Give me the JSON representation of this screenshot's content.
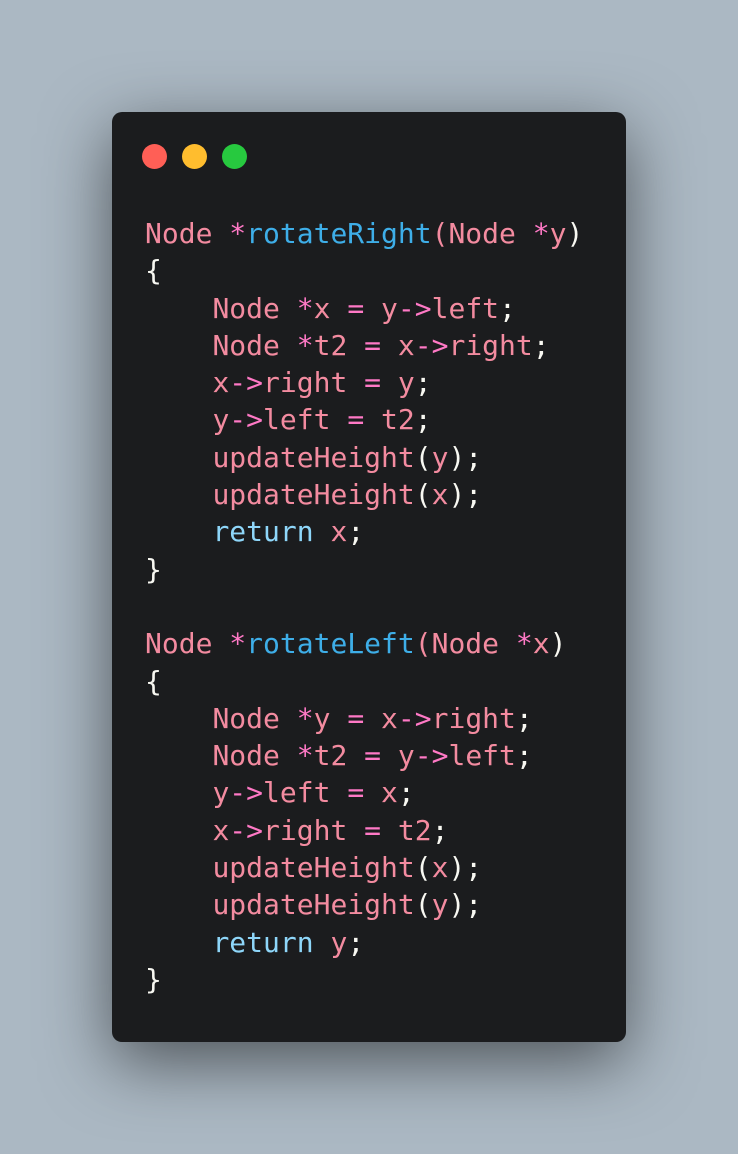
{
  "window": {
    "controls": [
      {
        "name": "close",
        "color": "#ff5f56"
      },
      {
        "name": "minimize",
        "color": "#ffbd2e"
      },
      {
        "name": "maximize",
        "color": "#27c93f"
      }
    ]
  },
  "palette": {
    "plain": "#f8f8f2",
    "pink": "#f38ba0",
    "operator": "#ff79c6",
    "function": "#3eaee8",
    "keyword": "#8ed6f9"
  },
  "code": {
    "lines": [
      [
        {
          "t": "Node",
          "c": "pink"
        },
        {
          "t": " ",
          "c": "plain"
        },
        {
          "t": "*",
          "c": "operator"
        },
        {
          "t": "rotateRight",
          "c": "function"
        },
        {
          "t": "(",
          "c": "pink"
        },
        {
          "t": "Node",
          "c": "pink"
        },
        {
          "t": " ",
          "c": "plain"
        },
        {
          "t": "*",
          "c": "operator"
        },
        {
          "t": "y",
          "c": "pink"
        },
        {
          "t": ")",
          "c": "plain"
        }
      ],
      [
        {
          "t": "{",
          "c": "plain"
        }
      ],
      [
        {
          "t": "    ",
          "c": "plain"
        },
        {
          "t": "Node",
          "c": "pink"
        },
        {
          "t": " ",
          "c": "plain"
        },
        {
          "t": "*",
          "c": "operator"
        },
        {
          "t": "x",
          "c": "pink"
        },
        {
          "t": " ",
          "c": "plain"
        },
        {
          "t": "=",
          "c": "operator"
        },
        {
          "t": " ",
          "c": "plain"
        },
        {
          "t": "y",
          "c": "pink"
        },
        {
          "t": "->",
          "c": "operator"
        },
        {
          "t": "left",
          "c": "pink"
        },
        {
          "t": ";",
          "c": "plain"
        }
      ],
      [
        {
          "t": "    ",
          "c": "plain"
        },
        {
          "t": "Node",
          "c": "pink"
        },
        {
          "t": " ",
          "c": "plain"
        },
        {
          "t": "*",
          "c": "operator"
        },
        {
          "t": "t2",
          "c": "pink"
        },
        {
          "t": " ",
          "c": "plain"
        },
        {
          "t": "=",
          "c": "operator"
        },
        {
          "t": " ",
          "c": "plain"
        },
        {
          "t": "x",
          "c": "pink"
        },
        {
          "t": "->",
          "c": "operator"
        },
        {
          "t": "right",
          "c": "pink"
        },
        {
          "t": ";",
          "c": "plain"
        }
      ],
      [
        {
          "t": "    ",
          "c": "plain"
        },
        {
          "t": "x",
          "c": "pink"
        },
        {
          "t": "->",
          "c": "operator"
        },
        {
          "t": "right",
          "c": "pink"
        },
        {
          "t": " ",
          "c": "plain"
        },
        {
          "t": "=",
          "c": "operator"
        },
        {
          "t": " ",
          "c": "plain"
        },
        {
          "t": "y",
          "c": "pink"
        },
        {
          "t": ";",
          "c": "plain"
        }
      ],
      [
        {
          "t": "    ",
          "c": "plain"
        },
        {
          "t": "y",
          "c": "pink"
        },
        {
          "t": "->",
          "c": "operator"
        },
        {
          "t": "left",
          "c": "pink"
        },
        {
          "t": " ",
          "c": "plain"
        },
        {
          "t": "=",
          "c": "operator"
        },
        {
          "t": " ",
          "c": "plain"
        },
        {
          "t": "t2",
          "c": "pink"
        },
        {
          "t": ";",
          "c": "plain"
        }
      ],
      [
        {
          "t": "    ",
          "c": "plain"
        },
        {
          "t": "updateHeight",
          "c": "pink"
        },
        {
          "t": "(",
          "c": "plain"
        },
        {
          "t": "y",
          "c": "pink"
        },
        {
          "t": ");",
          "c": "plain"
        }
      ],
      [
        {
          "t": "    ",
          "c": "plain"
        },
        {
          "t": "updateHeight",
          "c": "pink"
        },
        {
          "t": "(",
          "c": "plain"
        },
        {
          "t": "x",
          "c": "pink"
        },
        {
          "t": ");",
          "c": "plain"
        }
      ],
      [
        {
          "t": "    ",
          "c": "plain"
        },
        {
          "t": "return",
          "c": "keyword"
        },
        {
          "t": " ",
          "c": "plain"
        },
        {
          "t": "x",
          "c": "pink"
        },
        {
          "t": ";",
          "c": "plain"
        }
      ],
      [
        {
          "t": "}",
          "c": "plain"
        }
      ],
      [
        {
          "t": "",
          "c": "plain"
        }
      ],
      [
        {
          "t": "Node",
          "c": "pink"
        },
        {
          "t": " ",
          "c": "plain"
        },
        {
          "t": "*",
          "c": "operator"
        },
        {
          "t": "rotateLeft",
          "c": "function"
        },
        {
          "t": "(",
          "c": "pink"
        },
        {
          "t": "Node",
          "c": "pink"
        },
        {
          "t": " ",
          "c": "plain"
        },
        {
          "t": "*",
          "c": "operator"
        },
        {
          "t": "x",
          "c": "pink"
        },
        {
          "t": ")",
          "c": "plain"
        }
      ],
      [
        {
          "t": "{",
          "c": "plain"
        }
      ],
      [
        {
          "t": "    ",
          "c": "plain"
        },
        {
          "t": "Node",
          "c": "pink"
        },
        {
          "t": " ",
          "c": "plain"
        },
        {
          "t": "*",
          "c": "operator"
        },
        {
          "t": "y",
          "c": "pink"
        },
        {
          "t": " ",
          "c": "plain"
        },
        {
          "t": "=",
          "c": "operator"
        },
        {
          "t": " ",
          "c": "plain"
        },
        {
          "t": "x",
          "c": "pink"
        },
        {
          "t": "->",
          "c": "operator"
        },
        {
          "t": "right",
          "c": "pink"
        },
        {
          "t": ";",
          "c": "plain"
        }
      ],
      [
        {
          "t": "    ",
          "c": "plain"
        },
        {
          "t": "Node",
          "c": "pink"
        },
        {
          "t": " ",
          "c": "plain"
        },
        {
          "t": "*",
          "c": "operator"
        },
        {
          "t": "t2",
          "c": "pink"
        },
        {
          "t": " ",
          "c": "plain"
        },
        {
          "t": "=",
          "c": "operator"
        },
        {
          "t": " ",
          "c": "plain"
        },
        {
          "t": "y",
          "c": "pink"
        },
        {
          "t": "->",
          "c": "operator"
        },
        {
          "t": "left",
          "c": "pink"
        },
        {
          "t": ";",
          "c": "plain"
        }
      ],
      [
        {
          "t": "    ",
          "c": "plain"
        },
        {
          "t": "y",
          "c": "pink"
        },
        {
          "t": "->",
          "c": "operator"
        },
        {
          "t": "left",
          "c": "pink"
        },
        {
          "t": " ",
          "c": "plain"
        },
        {
          "t": "=",
          "c": "operator"
        },
        {
          "t": " ",
          "c": "plain"
        },
        {
          "t": "x",
          "c": "pink"
        },
        {
          "t": ";",
          "c": "plain"
        }
      ],
      [
        {
          "t": "    ",
          "c": "plain"
        },
        {
          "t": "x",
          "c": "pink"
        },
        {
          "t": "->",
          "c": "operator"
        },
        {
          "t": "right",
          "c": "pink"
        },
        {
          "t": " ",
          "c": "plain"
        },
        {
          "t": "=",
          "c": "operator"
        },
        {
          "t": " ",
          "c": "plain"
        },
        {
          "t": "t2",
          "c": "pink"
        },
        {
          "t": ";",
          "c": "plain"
        }
      ],
      [
        {
          "t": "    ",
          "c": "plain"
        },
        {
          "t": "updateHeight",
          "c": "pink"
        },
        {
          "t": "(",
          "c": "plain"
        },
        {
          "t": "x",
          "c": "pink"
        },
        {
          "t": ");",
          "c": "plain"
        }
      ],
      [
        {
          "t": "    ",
          "c": "plain"
        },
        {
          "t": "updateHeight",
          "c": "pink"
        },
        {
          "t": "(",
          "c": "plain"
        },
        {
          "t": "y",
          "c": "pink"
        },
        {
          "t": ");",
          "c": "plain"
        }
      ],
      [
        {
          "t": "    ",
          "c": "plain"
        },
        {
          "t": "return",
          "c": "keyword"
        },
        {
          "t": " ",
          "c": "plain"
        },
        {
          "t": "y",
          "c": "pink"
        },
        {
          "t": ";",
          "c": "plain"
        }
      ],
      [
        {
          "t": "}",
          "c": "plain"
        }
      ]
    ]
  }
}
